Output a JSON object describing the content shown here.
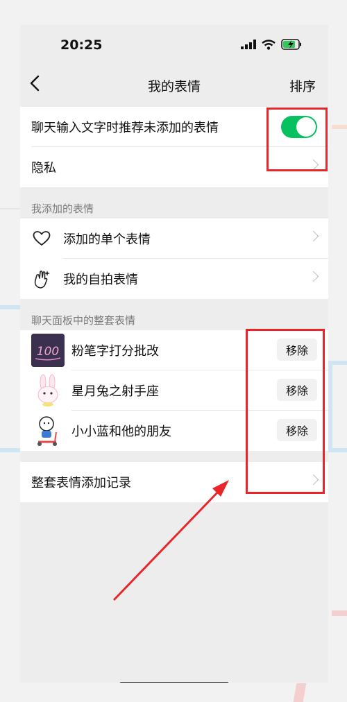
{
  "status_bar": {
    "time": "20:25"
  },
  "navbar": {
    "back_label": "‹",
    "title": "我的表情",
    "right_action": "排序"
  },
  "settings": {
    "recommend_label": "聊天输入文字时推荐未添加的表情",
    "recommend_enabled": true,
    "privacy_label": "隐私"
  },
  "my_added": {
    "header": "我添加的表情",
    "items": [
      {
        "label": "添加的单个表情",
        "icon": "heart-icon"
      },
      {
        "label": "我的自拍表情",
        "icon": "selfie-hand-icon"
      }
    ]
  },
  "panel_sets": {
    "header": "聊天面板中的整套表情",
    "items": [
      {
        "label": "粉笔字打分批改",
        "button": "移除",
        "thumb": "chalk-100-sticker"
      },
      {
        "label": "星月兔之射手座",
        "button": "移除",
        "thumb": "rabbit-sticker"
      },
      {
        "label": "小小蓝和他的朋友",
        "button": "移除",
        "thumb": "blue-scooter-sticker"
      }
    ]
  },
  "history": {
    "label": "整套表情添加记录"
  },
  "colors": {
    "toggle_on": "#07c160",
    "annotation": "#e8262a",
    "background": "#ededed"
  }
}
